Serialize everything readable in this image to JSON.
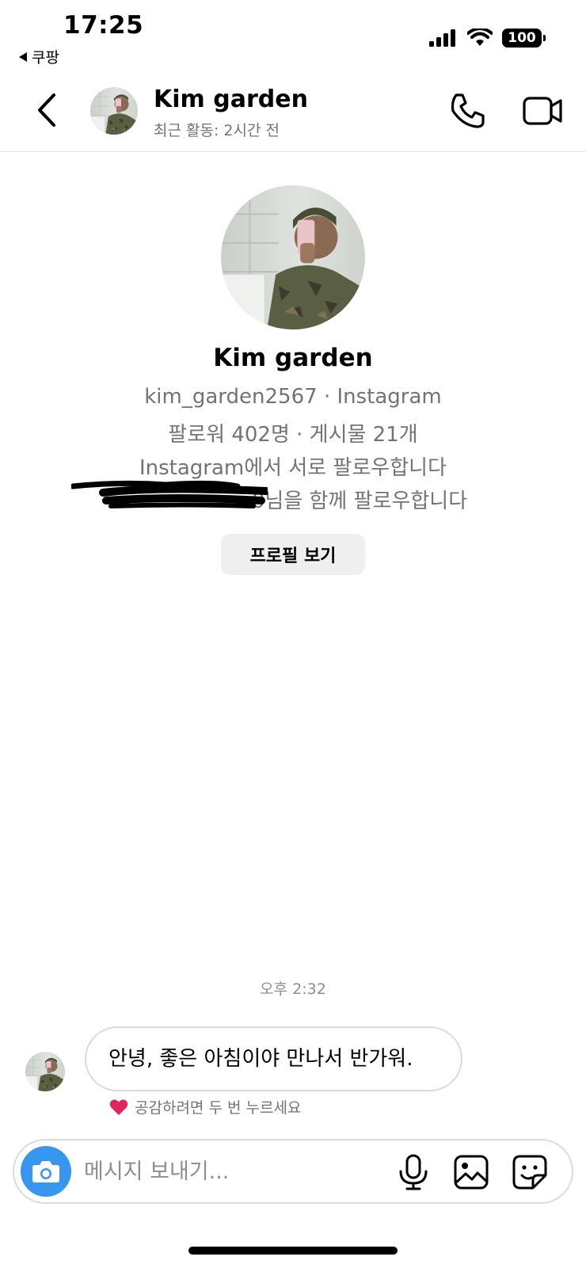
{
  "status_bar": {
    "time": "17:25",
    "back_app_label": "쿠팡",
    "battery": "100",
    "signal_icon": "signal-bars-icon",
    "wifi_icon": "wifi-icon"
  },
  "header": {
    "name": "Kim garden",
    "activity_status": "최근 활동: 2시간 전",
    "back_icon": "chevron-left-icon",
    "call_icon": "phone-icon",
    "video_icon": "video-camera-icon"
  },
  "profile": {
    "name": "Kim garden",
    "handle_line": "kim_garden2567 · Instagram",
    "stats_line": "팔로워 402명 · 게시물 21개",
    "mutual_line": "Instagram에서 서로 팔로우합니다",
    "common_follow_line": "0님을 함께 팔로우합니다",
    "view_profile_button": "프로필 보기"
  },
  "conversation": {
    "timestamp": "오후 2:32",
    "messages": [
      {
        "text": "안녕, 좋은 아침이야 만나서 반가워.",
        "reaction_hint": "공감하려면 두 번 누르세요"
      }
    ]
  },
  "composer": {
    "placeholder": "메시지 보내기...",
    "camera_icon": "camera-icon",
    "mic_icon": "microphone-icon",
    "gallery_icon": "image-icon",
    "sticker_icon": "sticker-icon"
  },
  "colors": {
    "accent_blue": "#3797f0",
    "secondary_text": "#737373",
    "heart": "#e0245e"
  }
}
